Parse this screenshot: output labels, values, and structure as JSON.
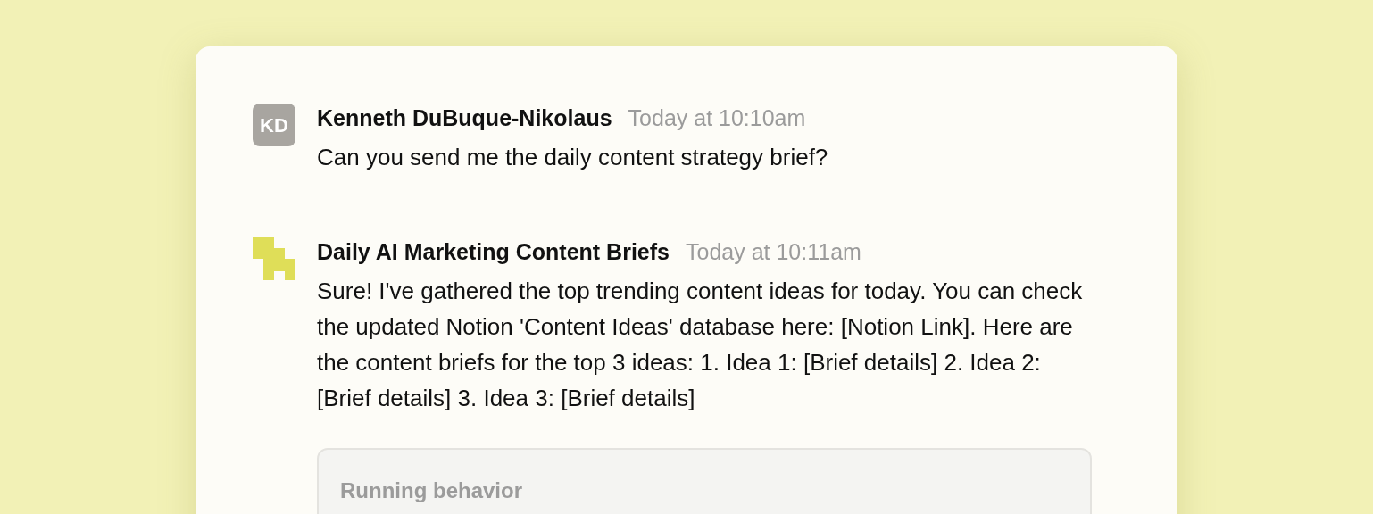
{
  "messages": [
    {
      "kind": "user",
      "avatar_initials": "KD",
      "author": "Kenneth DuBuque-Nikolaus",
      "time": "Today at 10:10am",
      "text": "Can you send me the daily content strategy brief?"
    },
    {
      "kind": "bot",
      "author": "Daily AI Marketing Content Briefs",
      "time": "Today at 10:11am",
      "text": "Sure! I've gathered the top trending content ideas for today. You can check the updated Notion 'Content Ideas' database here: [Notion Link]. Here are the content briefs for the top 3 ideas: 1. Idea 1: [Brief details] 2. Idea 2: [Brief details] 3. Idea 3: [Brief details]",
      "panel_title": "Running behavior"
    }
  ]
}
